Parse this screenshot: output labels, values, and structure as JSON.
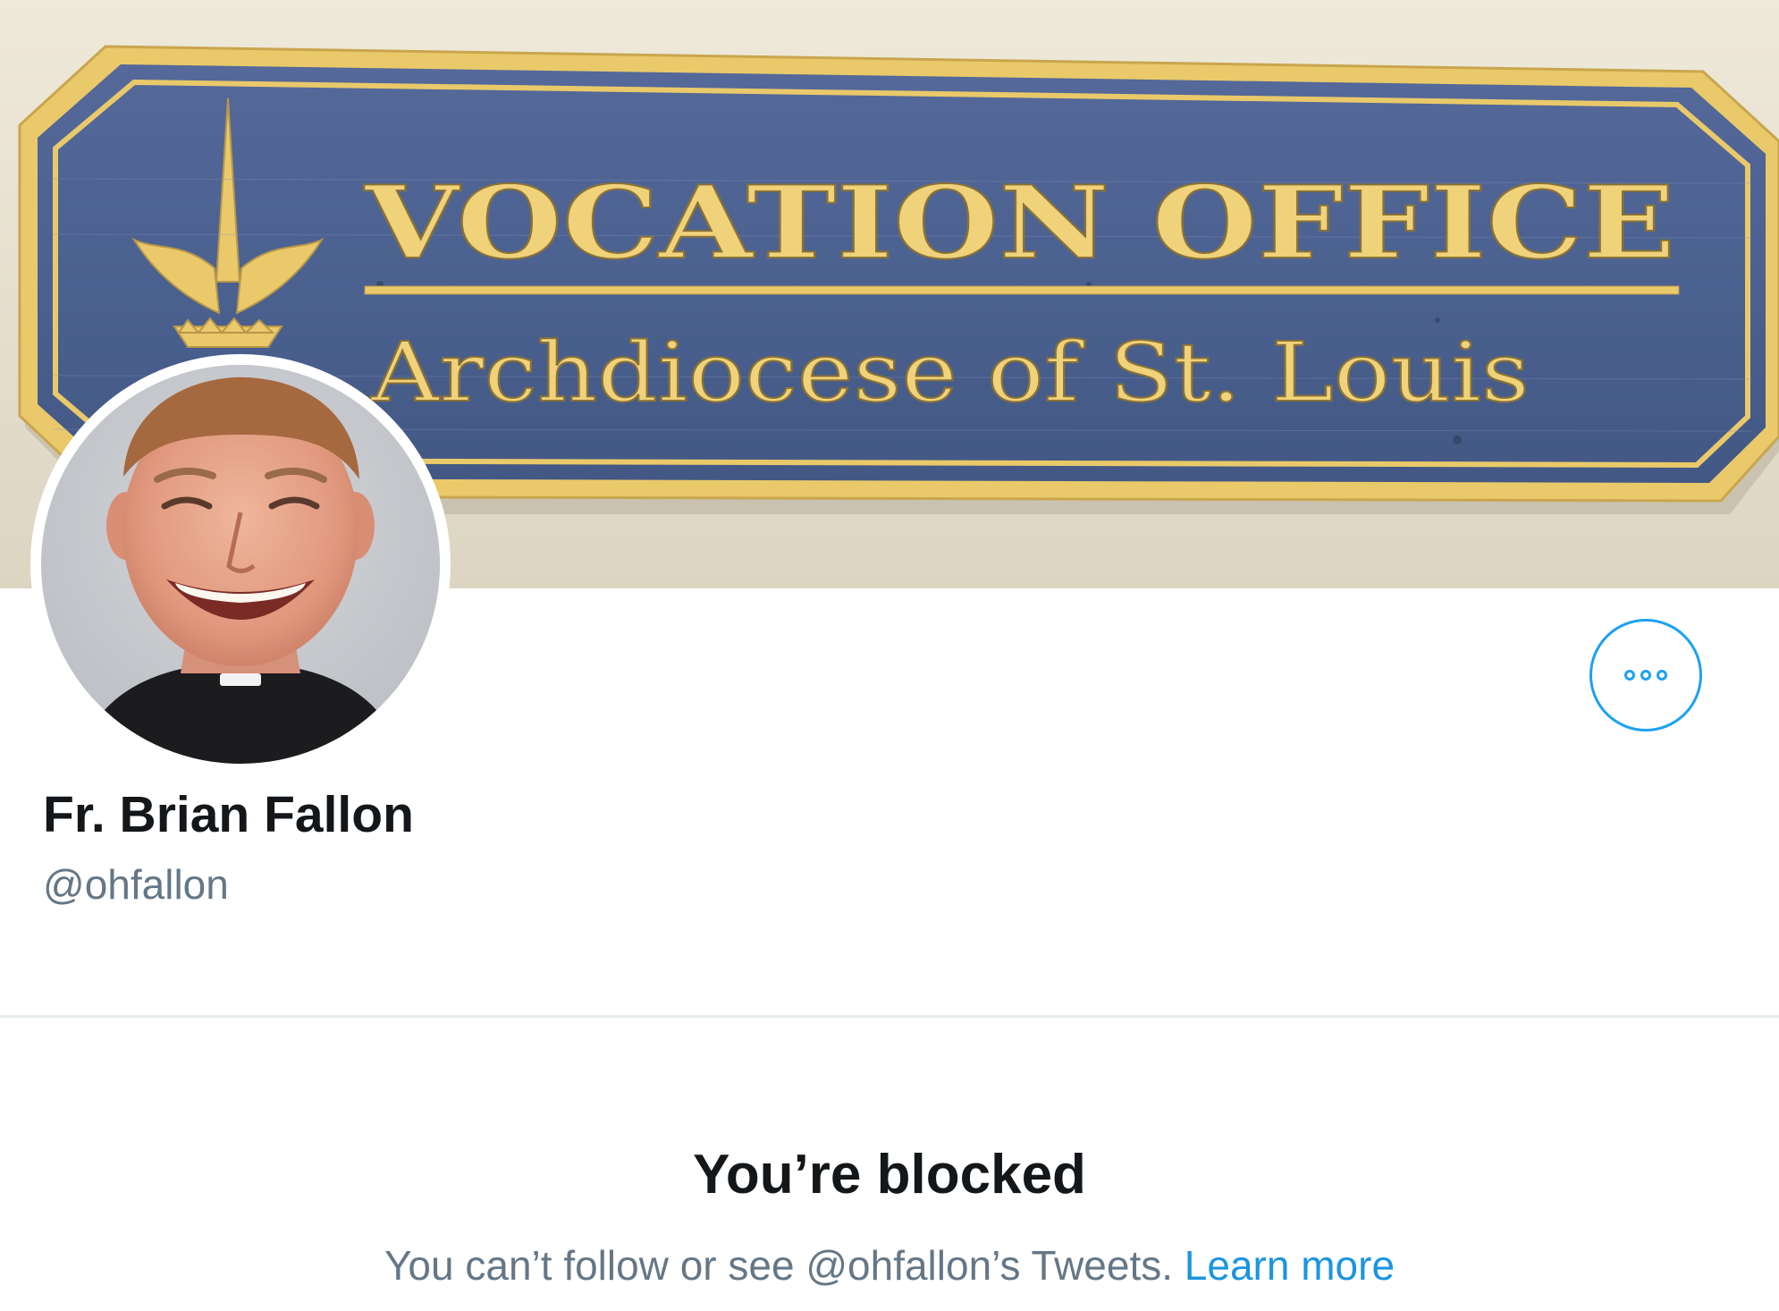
{
  "banner": {
    "sign_line1": "VOCATION OFFICE",
    "sign_line2": "Archdiocese of St. Louis"
  },
  "profile": {
    "display_name": "Fr. Brian Fallon",
    "handle": "@ohfallon"
  },
  "more_button": {
    "icon": "more-dots-icon"
  },
  "blocked": {
    "title": "You’re blocked",
    "description": "You can’t follow or see @ohfallon’s Tweets.",
    "learn_more": "Learn more"
  },
  "colors": {
    "accent": "#1da1f2",
    "link": "#1b95e0",
    "text_primary": "#14171a",
    "text_secondary": "#657786",
    "sign_blue": "#4d6592",
    "sign_gold": "#f0d27a"
  }
}
